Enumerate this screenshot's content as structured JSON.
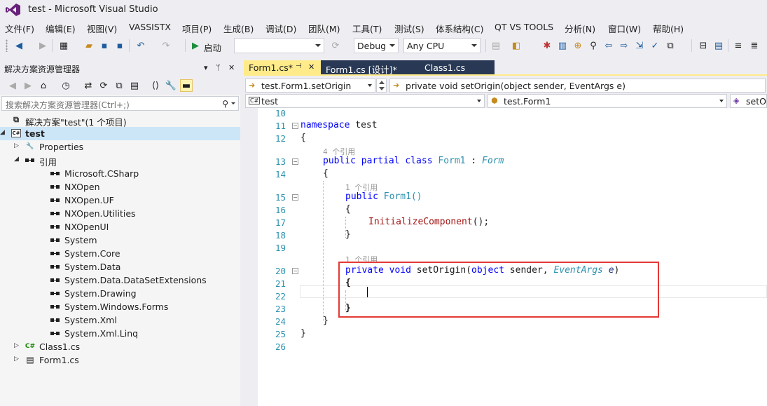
{
  "window": {
    "title": "test - Microsoft Visual Studio",
    "logo": "visual-studio-logo"
  },
  "menu": [
    "文件(F)",
    "编辑(E)",
    "视图(V)",
    "VASSISTX",
    "项目(P)",
    "生成(B)",
    "调试(D)",
    "团队(M)",
    "工具(T)",
    "测试(S)",
    "体系结构(C)",
    "QT VS TOOLS",
    "分析(N)",
    "窗口(W)",
    "帮助(H)"
  ],
  "toolbar": {
    "start_label": "启动",
    "config": "Debug",
    "platform": "Any CPU"
  },
  "solution_explorer": {
    "title": "解决方案资源管理器",
    "search_placeholder": "搜索解决方案资源管理器(Ctrl+;)",
    "header_buttons": [
      "▾",
      "ᛘ",
      "✕"
    ],
    "tree": [
      {
        "label": "解决方案\"test\"(1 个项目)",
        "icon": "solution-icon",
        "level": 0,
        "expander": ""
      },
      {
        "label": "test",
        "icon": "csharp-project-icon",
        "level": 0,
        "expander": "◢",
        "selected": true,
        "bold": true
      },
      {
        "label": "Properties",
        "icon": "wrench-icon",
        "level": 1,
        "expander": "▷"
      },
      {
        "label": "引用",
        "icon": "references-icon",
        "level": 1,
        "expander": "◢"
      },
      {
        "label": "Microsoft.CSharp",
        "icon": "reference-icon",
        "level": 2
      },
      {
        "label": "NXOpen",
        "icon": "reference-icon",
        "level": 2
      },
      {
        "label": "NXOpen.UF",
        "icon": "reference-icon",
        "level": 2
      },
      {
        "label": "NXOpen.Utilities",
        "icon": "reference-icon",
        "level": 2
      },
      {
        "label": "NXOpenUI",
        "icon": "reference-icon",
        "level": 2
      },
      {
        "label": "System",
        "icon": "reference-icon",
        "level": 2
      },
      {
        "label": "System.Core",
        "icon": "reference-icon",
        "level": 2
      },
      {
        "label": "System.Data",
        "icon": "reference-icon",
        "level": 2
      },
      {
        "label": "System.Data.DataSetExtensions",
        "icon": "reference-icon",
        "level": 2
      },
      {
        "label": "System.Drawing",
        "icon": "reference-icon",
        "level": 2
      },
      {
        "label": "System.Windows.Forms",
        "icon": "reference-icon",
        "level": 2
      },
      {
        "label": "System.Xml",
        "icon": "reference-icon",
        "level": 2
      },
      {
        "label": "System.Xml.Linq",
        "icon": "reference-icon",
        "level": 2
      },
      {
        "label": "Class1.cs",
        "icon": "csharp-file-icon",
        "level": 1,
        "expander": "▷"
      },
      {
        "label": "Form1.cs",
        "icon": "form-icon",
        "level": 1,
        "expander": "▷"
      }
    ]
  },
  "editor": {
    "tabs": [
      {
        "label": "Form1.cs*",
        "pin": "⊣",
        "close": "✕",
        "active": true
      },
      {
        "label": "Form1.cs [设计]*"
      },
      {
        "label": "Class1.cs"
      }
    ],
    "nav": {
      "member_left": "test.Form1.setOrigin",
      "member_right": "private void setOrigin(object sender, EventArgs e)",
      "project": "test",
      "class": "test.Form1",
      "member_short": "setOrigin"
    },
    "line_numbers": [
      "10",
      "11",
      "12",
      "13",
      "14",
      "15",
      "16",
      "17",
      "18",
      "19",
      "20",
      "21",
      "22",
      "23",
      "24",
      "25",
      "26"
    ],
    "hints": {
      "class_refs": "4 个引用",
      "ctor_refs": "1 个引用",
      "method_refs": "1 个引用"
    },
    "code": {
      "l11_kw": "namespace",
      "l11_name": " test",
      "l12": "{",
      "l13_kw": "public partial class",
      "l13_name": " Form1",
      "l13_colon": " : ",
      "l13_base": "Form",
      "l14": "{",
      "l15_kw": "public",
      "l15_name": " Form1()",
      "l16": "{",
      "l17_call": "InitializeComponent",
      "l17_rest": "();",
      "l18": "}",
      "l20_kw": "private void",
      "l20_name": " setOrigin(",
      "l20_obj": "object",
      "l20_sender": " sender, ",
      "l20_type": "EventArgs",
      "l20_param": " e",
      "l20_close": ")",
      "l21": "{",
      "l23": "}",
      "l24": "}",
      "l25": "}"
    }
  },
  "colors": {
    "tab_active": "#ffeb8a",
    "tab_inactive": "#293955",
    "highlight": "#e53935",
    "keyword": "#0000ff",
    "type": "#2b91af"
  }
}
